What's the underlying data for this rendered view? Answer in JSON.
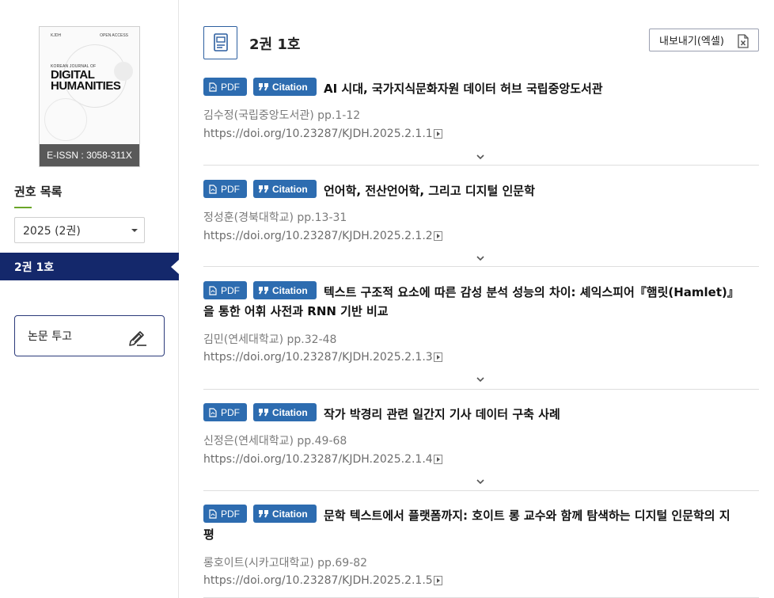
{
  "sidebar": {
    "cover": {
      "publisher": "KJDH",
      "open_access": "OPEN ACCESS",
      "journal_small": "KOREAN JOURNAL OF",
      "journal_line1": "DIGITAL",
      "journal_line2": "HUMANITIES",
      "issn": "E-ISSN : 3058-311X"
    },
    "volume_heading": "권호 목록",
    "year_select": "2025 (2권)",
    "active_issue": "2권 1호",
    "submit_label": "논문 투고"
  },
  "main": {
    "issue_title": "2권 1호",
    "export_label": "내보내기(엑셀)",
    "pdf_label": "PDF",
    "citation_label": "Citation",
    "articles": [
      {
        "title": "AI 시대, 국가지식문화자원 데이터 허브 국립중앙도서관",
        "author": "김수정(국립중앙도서관) pp.1-12",
        "doi": "https://doi.org/10.23287/KJDH.2025.2.1.1"
      },
      {
        "title": "언어학, 전산언어학, 그리고 디지털 인문학",
        "author": "정성훈(경북대학교) pp.13-31",
        "doi": "https://doi.org/10.23287/KJDH.2025.2.1.2"
      },
      {
        "title": "텍스트 구조적 요소에 따른 감성 분석 성능의 차이: 셰익스피어『햄릿(Hamlet)』",
        "title_cont": "을 통한 어휘 사전과 RNN 기반 비교",
        "author": "김민(연세대학교) pp.32-48",
        "doi": "https://doi.org/10.23287/KJDH.2025.2.1.3"
      },
      {
        "title": "작가 박경리 관련 일간지 기사 데이터 구축 사례",
        "author": "신정은(연세대학교) pp.49-68",
        "doi": "https://doi.org/10.23287/KJDH.2025.2.1.4"
      },
      {
        "title": "문학 텍스트에서 플랫폼까지: 호이트 롱 교수와 함께 탐색하는 디지털 인문학의 지",
        "title_cont": "평",
        "author": "롱호이트(시카고대학교) pp.69-82",
        "doi": "https://doi.org/10.23287/KJDH.2025.2.1.5"
      }
    ]
  },
  "colors": {
    "navy": "#14286b",
    "badge_blue": "#2d6cb0",
    "accent_green": "#6aa628"
  }
}
